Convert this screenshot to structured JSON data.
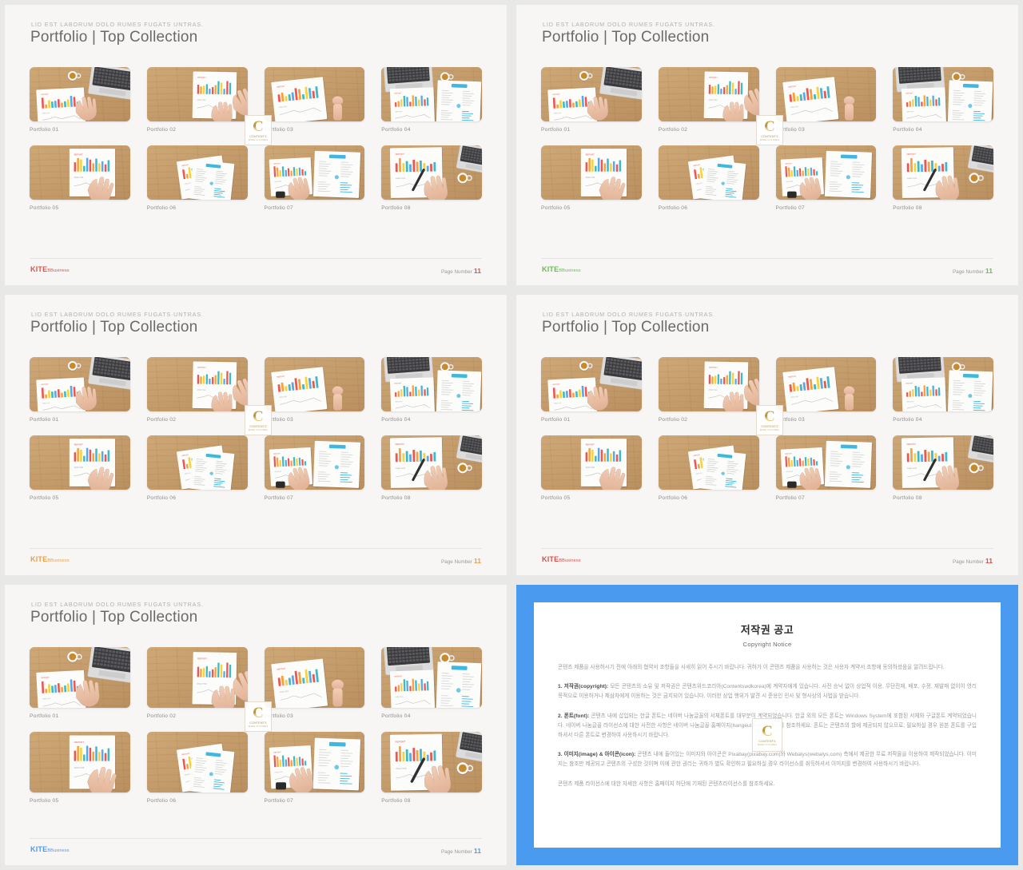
{
  "deck": {
    "eyebrow": "LID EST LABORUM  DOLO RUMES FUGATS  UNTRAS.",
    "title": "Portfolio | Top Collection",
    "page_label": "Page Number",
    "page_number": "11",
    "brand_name": "KITE",
    "brand_suffix": "BBusiness",
    "thumb_labels": [
      "Portfolio 01",
      "Portfolio 02",
      "Portfolio 03",
      "Portfolio 04",
      "Portfolio 05",
      "Portfolio 06",
      "Portfolio 07",
      "Portfolio 08"
    ]
  },
  "watermark": {
    "letter": "C",
    "line1": "CONTENTS",
    "line2": "MADE IN KOREA"
  },
  "slides": [
    {
      "id": "slide-1",
      "accent": "#d4574e"
    },
    {
      "id": "slide-2",
      "accent": "#6cba5a"
    },
    {
      "id": "slide-3",
      "accent": "#e8a04a"
    },
    {
      "id": "slide-4",
      "accent": "#d4504a"
    },
    {
      "id": "slide-5",
      "accent": "#4a9bf0"
    }
  ],
  "copyright": {
    "title": "저작권 공고",
    "subtitle": "Copyright Notice",
    "border_color": "#4a9bf0",
    "paragraphs": [
      {
        "lead": "",
        "text": "콘텐츠 제품을 사용하시기 전에 아래의 협약서 조항들을 사세히 읽어 주시기 바랍니다. 귀하가 이 콘텐츠 제품을 사용하는 것은 사용자 계약서 조항에 동의하셨음을 알려드립니다."
      },
      {
        "lead": "1. 저작권(copyright):",
        "text": "모든 콘텐츠의 소유 및 저작권은 콘텐츠위드코리아(Contentswdkorea)에 계약자에게 있습니다. 사전 승낙 없이 상업적 이용, 무단전재, 배포, 수정, 재발매 없이이 영리 목적으로 이용하거나 제삼자에게 이용하는 것은 금지되어 있습니다. 이러한 상업 행위가 발견 시 준용인 민사 및 형사상의 사법을 받습니다."
      },
      {
        "lead": "2. 폰트(font):",
        "text": "콘텐츠 내에 삽입되는 한글 폰트는 네이버 나눔글꼴의 서체폰트를 대부분이 계약되었습니다. 한글 외의 모든 폰트는 Windows System에 포함된 서체와 구글폰트 계약되었습니다. 네이버 나눔글꼴 라이선스에 대한 사전한 사항은 네이버 나눔글꼴 홈페이지(hangeul.naver.com)를 참조하세요. 폰트는 콘텐츠의 할에 제공되지 않으므로, 필요하실 경우 원본 폰트를 구입하셔서 다른 폰트로 변경하여 사용하시기 바랍니다."
      },
      {
        "lead": "3. 이미지(image) & 아이콘(icon):",
        "text": "콘텐츠 내에 들어있는 이미지와 아이콘은 Pixabay(pixabay.com)와 Webalys(webalys.com) 측에서 제공한 무료 저작물을 이용하여 제작되었습니다. 이미지는 참조만 제공되고 콘텐츠의 구성한 것이며 이에 관한 권리는 귀하가 별도 확인하고 필요하실 경우 라이선스를 취득하셔서 이미지를 변경하여 사용하시기 바랍니다."
      },
      {
        "lead": "",
        "text": "콘텐츠 제품 라이선스에 대한 자세한 사항은 홈페이지 하단에 기재된 콘텐츠라이선스를 참조하세요."
      }
    ]
  },
  "photos": [
    {
      "name": "photo-desk-laptop-coffee-chart",
      "desc": "Top view wood desk with laptop, coffee cup and bar chart paper with hand"
    },
    {
      "name": "photo-hands-holding-chart-sheet",
      "desc": "Hands holding a bar chart sheet on wood desk"
    },
    {
      "name": "photo-fist-beside-chart-sheet",
      "desc": "Bar chart sheet on wood desk with a closed hand"
    },
    {
      "name": "photo-laptop-coffee-two-reports",
      "desc": "Laptop, coffee and two report sheets on wood desk"
    },
    {
      "name": "photo-finger-pointing-chart",
      "desc": "Finger pointing at a bar chart sheet on wood desk"
    },
    {
      "name": "photo-two-stacked-reports",
      "desc": "Two stacked report sheets on wood desk"
    },
    {
      "name": "photo-watch-hand-two-reports",
      "desc": "Hand with watch pointing at chart next to report sheet"
    },
    {
      "name": "photo-pen-marking-chart-coffee",
      "desc": "Hand with pen marking a chart, coffee and laptop on desk"
    }
  ]
}
